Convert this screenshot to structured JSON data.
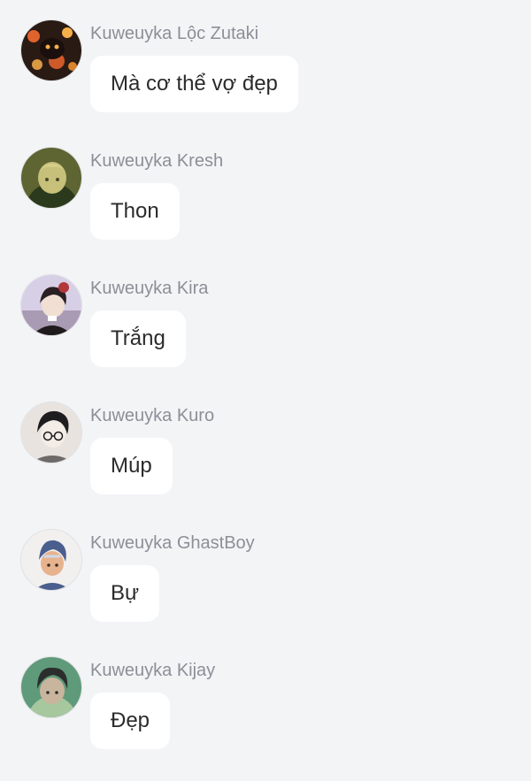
{
  "messages": [
    {
      "sender": "Kuweuyka Lộc Zutaki",
      "text": "Mà cơ thể vợ đẹp",
      "avatar_icon": "avatar-night-lanterns",
      "avatar_colors": [
        "#2a1a14",
        "#e0622c",
        "#f6b04a"
      ]
    },
    {
      "sender": "Kuweuyka Kresh",
      "text": "Thon",
      "avatar_icon": "avatar-blond-character",
      "avatar_colors": [
        "#5e6432",
        "#c7c07a",
        "#2b3a1c"
      ]
    },
    {
      "sender": "Kuweuyka Kira",
      "text": "Trắng",
      "avatar_icon": "avatar-dark-hair-character",
      "avatar_colors": [
        "#d7cfe6",
        "#2a1f22",
        "#b2373a"
      ]
    },
    {
      "sender": "Kuweuyka Kuro",
      "text": "Múp",
      "avatar_icon": "avatar-glasses-character",
      "avatar_colors": [
        "#e8e3df",
        "#1e1c1f",
        "#6e6a69"
      ]
    },
    {
      "sender": "Kuweuyka GhastBoy",
      "text": "Bự",
      "avatar_icon": "avatar-blue-hair-character",
      "avatar_colors": [
        "#f1f0ef",
        "#4a5f8e",
        "#e6b38e"
      ]
    },
    {
      "sender": "Kuweuyka Kijay",
      "text": "Đẹp",
      "avatar_icon": "avatar-green-background-character",
      "avatar_colors": [
        "#5f9a7a",
        "#2b2e2c",
        "#a7c79e"
      ]
    }
  ]
}
